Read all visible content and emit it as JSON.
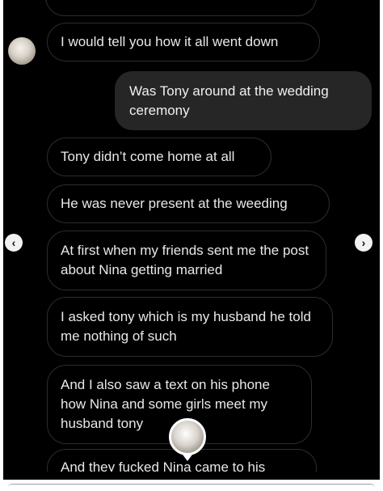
{
  "messages": [
    {
      "from": "them",
      "text": ""
    },
    {
      "from": "them",
      "text": "I would tell you how it all went down"
    },
    {
      "from": "me",
      "text": "Was Tony around at the wedding ceremony"
    },
    {
      "from": "them",
      "text": "Tony didn’t come home at all"
    },
    {
      "from": "them",
      "text": "He was never present at the weeding"
    },
    {
      "from": "them",
      "text": "At first when my friends sent me the post about Nina getting married"
    },
    {
      "from": "them",
      "text": "I asked tony which is my husband he told me nothing of such"
    },
    {
      "from": "them",
      "text": "And I also saw a text on his phone how Nina and some girls meet my husband tony"
    },
    {
      "from": "them",
      "text": "And they fucked Nina came to his"
    }
  ],
  "nav": {
    "prev": "‹",
    "next": "›"
  },
  "colors": {
    "background": "#000000",
    "outgoing_bubble": "#262626",
    "incoming_border": "#2d2d2d"
  }
}
